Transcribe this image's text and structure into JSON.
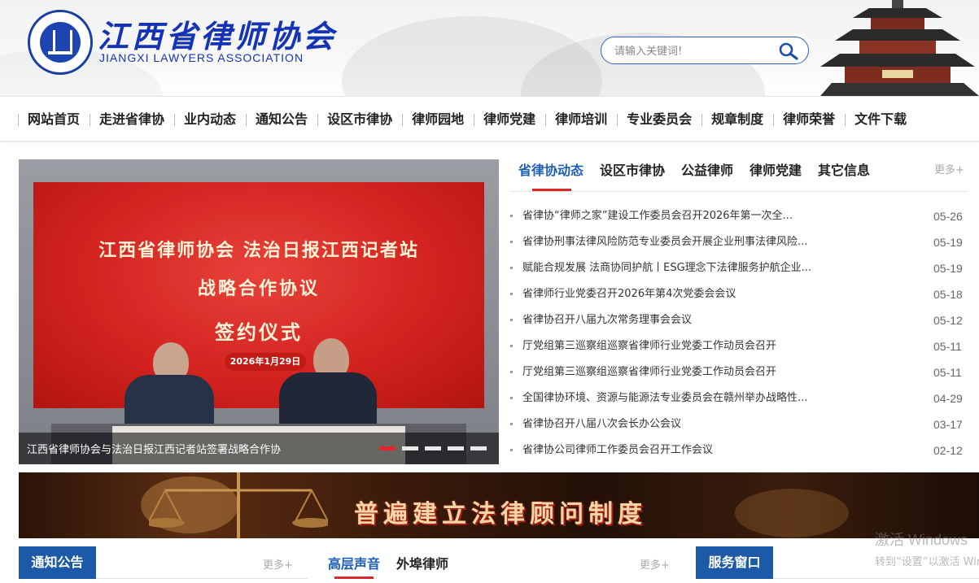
{
  "site": {
    "name_cn": "江西省律师协会",
    "name_en": "JIANGXI LAWYERS ASSOCIATION",
    "search_placeholder": "请输入关键词!"
  },
  "nav": [
    "网站首页",
    "走进省律协",
    "业内动态",
    "通知公告",
    "设区市律协",
    "律师园地",
    "律师党建",
    "律师培训",
    "专业委员会",
    "规章制度",
    "律师荣誉",
    "文件下载"
  ],
  "slider": {
    "banner_line1": "江西省律师协会 法治日报江西记者站",
    "banner_line2": "战略合作协议",
    "banner_line3": "签约仪式",
    "banner_date": "2026年1月29日",
    "caption": "江西省律师协会与法治日报江西记者站签署战略合作协",
    "slide_count": 5,
    "active_slide": 1
  },
  "news": {
    "tabs": [
      "省律协动态",
      "设区市律协",
      "公益律师",
      "律师党建",
      "其它信息"
    ],
    "active_tab": 0,
    "more": "更多+",
    "items": [
      {
        "title": "省律协“律师之家”建设工作委员会召开2026年第一次全...",
        "date": "05-26"
      },
      {
        "title": "省律协刑事法律风险防范专业委员会开展企业刑事法律风险...",
        "date": "05-19"
      },
      {
        "title": "赋能合规发展 法商协同护航丨ESG理念下法律服务护航企业...",
        "date": "05-19"
      },
      {
        "title": "省律师行业党委召开2026年第4次党委会会议",
        "date": "05-18"
      },
      {
        "title": "省律协召开八届九次常务理事会会议",
        "date": "05-12"
      },
      {
        "title": "厅党组第三巡察组巡察省律师行业党委工作动员会召开",
        "date": "05-11"
      },
      {
        "title": "厅党组第三巡察组巡察省律师行业党委工作动员会召开",
        "date": "05-11"
      },
      {
        "title": "全国律协环境、资源与能源法专业委员会在赣州举办战略性...",
        "date": "04-29"
      },
      {
        "title": "省律协召开八届八次会长办公会议",
        "date": "03-17"
      },
      {
        "title": "省律协公司律师工作委员会召开工作会议",
        "date": "02-12"
      }
    ]
  },
  "promo": {
    "text": "普遍建立法律顾问制度"
  },
  "bottom": {
    "notice": {
      "title": "通知公告",
      "more": "更多+"
    },
    "voice": {
      "tabs": [
        "高层声音",
        "外埠律师"
      ],
      "more": "更多+"
    },
    "service": {
      "title": "服务窗口"
    }
  },
  "watermark": {
    "line1": "激活 Windows",
    "line2": "转到“设置”以激活 Windows。"
  },
  "colors": {
    "brand_blue": "#1c5aa8",
    "accent_red": "#d52a27",
    "logo_blue": "#1533b5"
  },
  "icons": [
    "search-icon",
    "association-emblem",
    "pagoda-illustration"
  ]
}
